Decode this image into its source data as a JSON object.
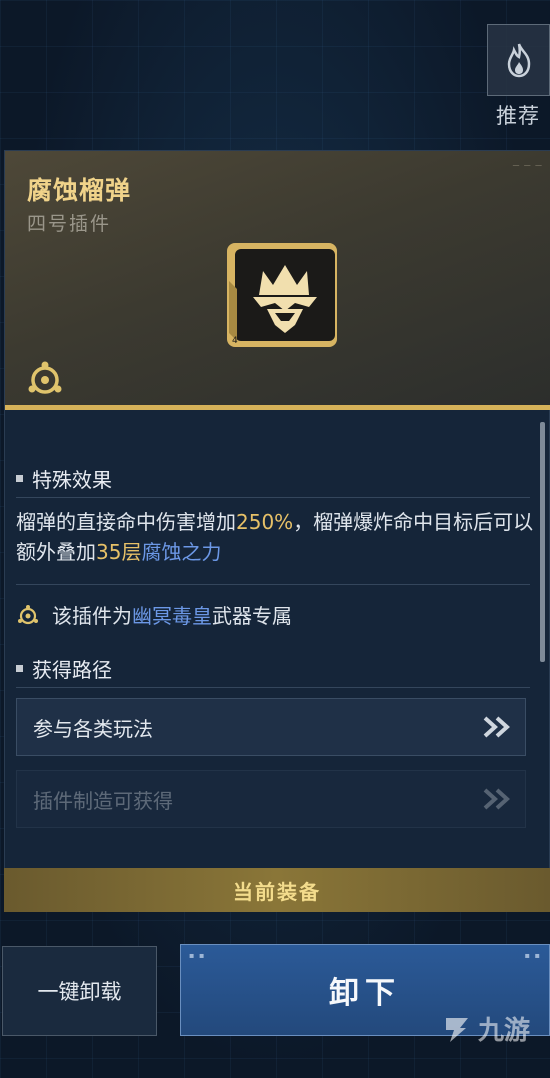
{
  "recommend": {
    "label": "推荐",
    "icon": "flame-icon"
  },
  "item": {
    "name": "腐蚀榴弹",
    "type": "四号插件",
    "icon": "crown-emblem-icon",
    "slot_number": "4",
    "module_icon": "module-gear-icon"
  },
  "effect": {
    "title": "特殊效果",
    "text_1": "榴弹的直接命中伤害增加",
    "value_1": "250%",
    "text_2": "，榴弹爆炸命中目标后可以额外叠加",
    "value_2": "35层",
    "keyword": "腐蚀之力"
  },
  "exclusive": {
    "prefix": "该插件为",
    "weapon": "幽冥毒皇",
    "suffix": "武器专属"
  },
  "routes": {
    "title": "获得路径",
    "items": [
      {
        "label": "参与各类玩法"
      },
      {
        "label": "插件制造可获得"
      }
    ]
  },
  "equipped_label": "当前装备",
  "buttons": {
    "unload_all": "一键卸载",
    "unequip": "卸下"
  },
  "watermark": "九游",
  "colors": {
    "gold": "#e7c168",
    "blue_link": "#6c98e6",
    "accent_bar": "#d6b259",
    "primary_button": "#2b5a98"
  }
}
